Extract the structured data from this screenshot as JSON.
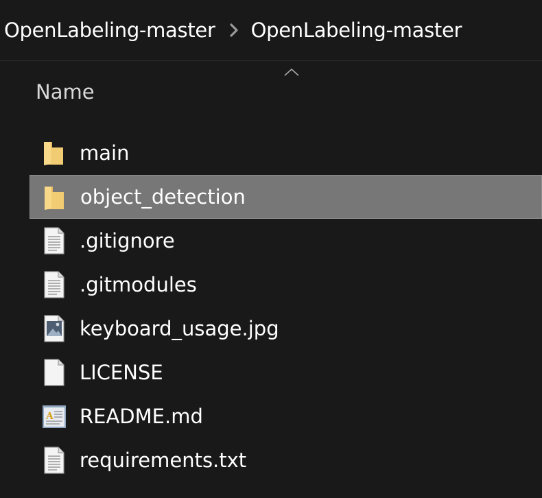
{
  "breadcrumb": {
    "items": [
      {
        "label": "OpenLabeling-master"
      },
      {
        "label": "OpenLabeling-master"
      }
    ]
  },
  "columns": {
    "name_header": "Name",
    "sort": "ascending"
  },
  "files": [
    {
      "name": "main",
      "type": "folder",
      "selected": false
    },
    {
      "name": "object_detection",
      "type": "folder",
      "selected": true
    },
    {
      "name": ".gitignore",
      "type": "text-file",
      "selected": false
    },
    {
      "name": ".gitmodules",
      "type": "text-file",
      "selected": false
    },
    {
      "name": "keyboard_usage.jpg",
      "type": "image-file",
      "selected": false
    },
    {
      "name": "LICENSE",
      "type": "blank-file",
      "selected": false
    },
    {
      "name": "README.md",
      "type": "markdown-file",
      "selected": false
    },
    {
      "name": "requirements.txt",
      "type": "text-file",
      "selected": false
    }
  ],
  "colors": {
    "background": "#191919",
    "selection": "#777777",
    "folder": "#f2cc72",
    "text": "#ffffff"
  }
}
